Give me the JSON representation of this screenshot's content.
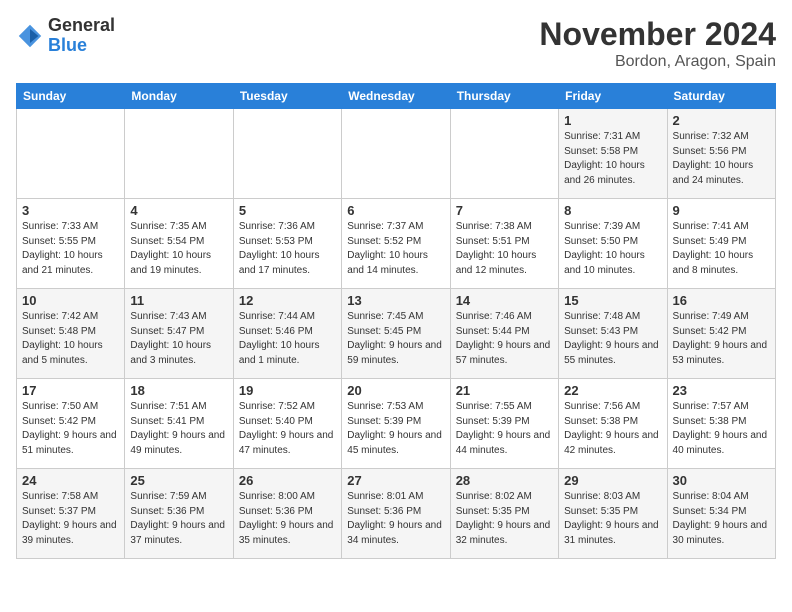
{
  "header": {
    "logo_general": "General",
    "logo_blue": "Blue",
    "month_title": "November 2024",
    "location": "Bordon, Aragon, Spain"
  },
  "days_of_week": [
    "Sunday",
    "Monday",
    "Tuesday",
    "Wednesday",
    "Thursday",
    "Friday",
    "Saturday"
  ],
  "weeks": [
    [
      {
        "day": "",
        "info": ""
      },
      {
        "day": "",
        "info": ""
      },
      {
        "day": "",
        "info": ""
      },
      {
        "day": "",
        "info": ""
      },
      {
        "day": "",
        "info": ""
      },
      {
        "day": "1",
        "info": "Sunrise: 7:31 AM\nSunset: 5:58 PM\nDaylight: 10 hours and 26 minutes."
      },
      {
        "day": "2",
        "info": "Sunrise: 7:32 AM\nSunset: 5:56 PM\nDaylight: 10 hours and 24 minutes."
      }
    ],
    [
      {
        "day": "3",
        "info": "Sunrise: 7:33 AM\nSunset: 5:55 PM\nDaylight: 10 hours and 21 minutes."
      },
      {
        "day": "4",
        "info": "Sunrise: 7:35 AM\nSunset: 5:54 PM\nDaylight: 10 hours and 19 minutes."
      },
      {
        "day": "5",
        "info": "Sunrise: 7:36 AM\nSunset: 5:53 PM\nDaylight: 10 hours and 17 minutes."
      },
      {
        "day": "6",
        "info": "Sunrise: 7:37 AM\nSunset: 5:52 PM\nDaylight: 10 hours and 14 minutes."
      },
      {
        "day": "7",
        "info": "Sunrise: 7:38 AM\nSunset: 5:51 PM\nDaylight: 10 hours and 12 minutes."
      },
      {
        "day": "8",
        "info": "Sunrise: 7:39 AM\nSunset: 5:50 PM\nDaylight: 10 hours and 10 minutes."
      },
      {
        "day": "9",
        "info": "Sunrise: 7:41 AM\nSunset: 5:49 PM\nDaylight: 10 hours and 8 minutes."
      }
    ],
    [
      {
        "day": "10",
        "info": "Sunrise: 7:42 AM\nSunset: 5:48 PM\nDaylight: 10 hours and 5 minutes."
      },
      {
        "day": "11",
        "info": "Sunrise: 7:43 AM\nSunset: 5:47 PM\nDaylight: 10 hours and 3 minutes."
      },
      {
        "day": "12",
        "info": "Sunrise: 7:44 AM\nSunset: 5:46 PM\nDaylight: 10 hours and 1 minute."
      },
      {
        "day": "13",
        "info": "Sunrise: 7:45 AM\nSunset: 5:45 PM\nDaylight: 9 hours and 59 minutes."
      },
      {
        "day": "14",
        "info": "Sunrise: 7:46 AM\nSunset: 5:44 PM\nDaylight: 9 hours and 57 minutes."
      },
      {
        "day": "15",
        "info": "Sunrise: 7:48 AM\nSunset: 5:43 PM\nDaylight: 9 hours and 55 minutes."
      },
      {
        "day": "16",
        "info": "Sunrise: 7:49 AM\nSunset: 5:42 PM\nDaylight: 9 hours and 53 minutes."
      }
    ],
    [
      {
        "day": "17",
        "info": "Sunrise: 7:50 AM\nSunset: 5:42 PM\nDaylight: 9 hours and 51 minutes."
      },
      {
        "day": "18",
        "info": "Sunrise: 7:51 AM\nSunset: 5:41 PM\nDaylight: 9 hours and 49 minutes."
      },
      {
        "day": "19",
        "info": "Sunrise: 7:52 AM\nSunset: 5:40 PM\nDaylight: 9 hours and 47 minutes."
      },
      {
        "day": "20",
        "info": "Sunrise: 7:53 AM\nSunset: 5:39 PM\nDaylight: 9 hours and 45 minutes."
      },
      {
        "day": "21",
        "info": "Sunrise: 7:55 AM\nSunset: 5:39 PM\nDaylight: 9 hours and 44 minutes."
      },
      {
        "day": "22",
        "info": "Sunrise: 7:56 AM\nSunset: 5:38 PM\nDaylight: 9 hours and 42 minutes."
      },
      {
        "day": "23",
        "info": "Sunrise: 7:57 AM\nSunset: 5:38 PM\nDaylight: 9 hours and 40 minutes."
      }
    ],
    [
      {
        "day": "24",
        "info": "Sunrise: 7:58 AM\nSunset: 5:37 PM\nDaylight: 9 hours and 39 minutes."
      },
      {
        "day": "25",
        "info": "Sunrise: 7:59 AM\nSunset: 5:36 PM\nDaylight: 9 hours and 37 minutes."
      },
      {
        "day": "26",
        "info": "Sunrise: 8:00 AM\nSunset: 5:36 PM\nDaylight: 9 hours and 35 minutes."
      },
      {
        "day": "27",
        "info": "Sunrise: 8:01 AM\nSunset: 5:36 PM\nDaylight: 9 hours and 34 minutes."
      },
      {
        "day": "28",
        "info": "Sunrise: 8:02 AM\nSunset: 5:35 PM\nDaylight: 9 hours and 32 minutes."
      },
      {
        "day": "29",
        "info": "Sunrise: 8:03 AM\nSunset: 5:35 PM\nDaylight: 9 hours and 31 minutes."
      },
      {
        "day": "30",
        "info": "Sunrise: 8:04 AM\nSunset: 5:34 PM\nDaylight: 9 hours and 30 minutes."
      }
    ]
  ]
}
